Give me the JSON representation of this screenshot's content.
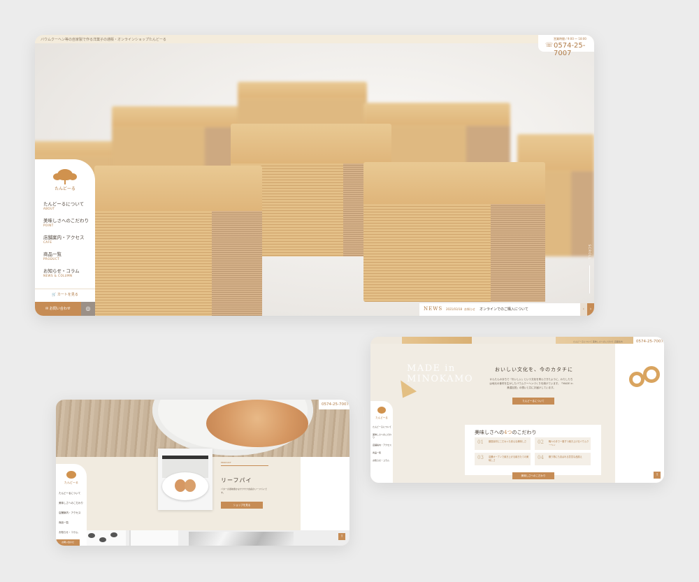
{
  "main": {
    "tagline": "バウムクーヘン等の自家製で作る洋菓子の通販・オンラインショップたんどーる",
    "phone": {
      "hours": "営業時間 / 9:00 ～ 18:00",
      "number": "0574-25-7007"
    },
    "logo_text": "たんどーる",
    "nav": [
      {
        "ja": "たんどーるについて",
        "en": "ABOUT"
      },
      {
        "ja": "美味しさへのこだわり",
        "en": "POINT"
      },
      {
        "ja": "店舗案内・アクセス",
        "en": "CAFE"
      },
      {
        "ja": "商品一覧",
        "en": "PRODUCT"
      },
      {
        "ja": "お知らせ・コラム",
        "en": "NEWS & COLUMN"
      }
    ],
    "cart_label": "カートを見る",
    "contact_label": "お問い合わせ",
    "instagram_icon": "instagram-icon",
    "scroll_label": "SCROLL",
    "news": {
      "label": "NEWS",
      "date": "2021/03/18",
      "category": "お知らせ",
      "title": "オンラインでのご購入について"
    }
  },
  "right": {
    "phone": "0574-25-7007",
    "top_nav": "たんどーるについて  美味しさへのこだわり  店舗案内",
    "made_line1": "MADE in",
    "made_line2": "MINOKAMO",
    "heading": "おいしい文化を、今のカタチに",
    "body": "かんたんのまちで「おいしい」という文化を育んできたように、わたしたちは地元の食材を生かしたバウムクーヘンづくりを続けています。「MADE in 美濃加茂」の想いと共にお届けしています。",
    "button1": "たんどーるについて",
    "points_title_pre": "美味しさへの",
    "points_title_accent": "4つ",
    "points_title_post": "のこだわり",
    "points": [
      {
        "num": "01",
        "text": "厳選素材にこだわった安心な美味しさ"
      },
      {
        "num": "02",
        "text": "職人の手で一層ずつ焼き上げるバウムクーヘン"
      },
      {
        "num": "03",
        "text": "店舗オーブンで焼き上げる焼きたての美味しさ"
      },
      {
        "num": "04",
        "text": "贈り物にも喜ばれる豊富な品揃え"
      }
    ],
    "button2": "美味しさへのこだわり",
    "side_nav": [
      "たんどーるについて",
      "美味しさへのこだわり",
      "店舗案内・アクセス",
      "商品一覧",
      "お知らせ・コラム"
    ],
    "logo_text": "たんどーる"
  },
  "left": {
    "phone": "0574-25-7007",
    "sub": "PRODUCT",
    "title": "リーフパイ",
    "desc": "バターの風味豊かなサクサク食感のリーフパイです。",
    "button": "ショップを見る",
    "logo_text": "たんどーる",
    "side_nav": [
      "たんどーるについて",
      "美味しさへのこだわり",
      "店舗案内・アクセス",
      "商品一覧",
      "お知らせ・コラム"
    ],
    "contact_label": "お問い合わせ"
  }
}
